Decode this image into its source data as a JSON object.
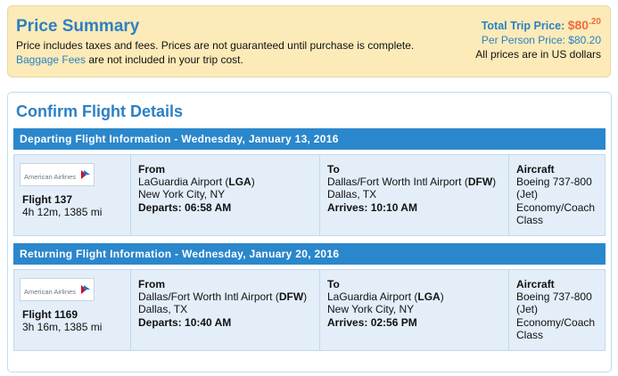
{
  "summary": {
    "title": "Price Summary",
    "line1": "Price includes taxes and fees. Prices are not guaranteed until purchase is complete.",
    "baggage_link": "Baggage Fees",
    "line2_rest": " are not included in your trip cost.",
    "total_label": "Total Trip Price: ",
    "total_amount": "$80",
    "total_cents": ".20",
    "per_person_label": "Per Person Price: ",
    "per_person_amount": "$80.20",
    "currency_note": "All prices are in US dollars"
  },
  "confirm": {
    "title": "Confirm Flight Details",
    "departing": {
      "header": "Departing Flight Information - Wednesday, January 13, 2016",
      "airline": "American Airlines",
      "flight": "Flight 137",
      "duration": "4h 12m, 1385 mi",
      "from_label": "From",
      "from_airport": "LaGuardia Airport (",
      "from_code": "LGA",
      "from_city": "New York City, NY",
      "departs_label": "Departs:",
      "departs_time": "06:58 AM",
      "to_label": "To",
      "to_airport": "Dallas/Fort Worth Intl Airport (",
      "to_code": "DFW",
      "to_city": "Dallas, TX",
      "arrives_label": "Arrives:",
      "arrives_time": "10:10 AM",
      "aircraft_label": "Aircraft",
      "aircraft_model": "Boeing 737-800",
      "aircraft_type": "(Jet)",
      "cabin_1": "Economy/Coach",
      "cabin_2": "Class"
    },
    "returning": {
      "header": "Returning Flight Information - Wednesday, January 20, 2016",
      "airline": "American Airlines",
      "flight": "Flight 1169",
      "duration": "3h 16m, 1385 mi",
      "from_label": "From",
      "from_airport": "Dallas/Fort Worth Intl Airport (",
      "from_code": "DFW",
      "from_city": "Dallas, TX",
      "departs_label": "Departs:",
      "departs_time": "10:40 AM",
      "to_label": "To",
      "to_airport": "LaGuardia Airport (",
      "to_code": "LGA",
      "to_city": "New York City, NY",
      "arrives_label": "Arrives:",
      "arrives_time": "02:56 PM",
      "aircraft_label": "Aircraft",
      "aircraft_model": "Boeing 737-800",
      "aircraft_type": "(Jet)",
      "cabin_1": "Economy/Coach",
      "cabin_2": "Class"
    }
  },
  "colors": {
    "accent": "#2c80c4",
    "price": "#f06b3f",
    "bar": "#2b87cc",
    "summary_bg": "#fcebb8",
    "row_bg": "#e3eef9"
  }
}
